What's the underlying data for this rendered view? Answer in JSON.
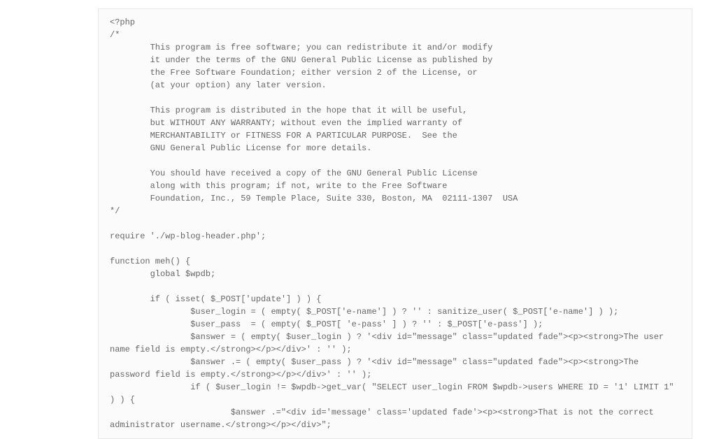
{
  "code_lines": [
    "<?php",
    "/*",
    "        This program is free software; you can redistribute it and/or modify",
    "        it under the terms of the GNU General Public License as published by",
    "        the Free Software Foundation; either version 2 of the License, or",
    "        (at your option) any later version.",
    "",
    "        This program is distributed in the hope that it will be useful,",
    "        but WITHOUT ANY WARRANTY; without even the implied warranty of",
    "        MERCHANTABILITY or FITNESS FOR A PARTICULAR PURPOSE.  See the",
    "        GNU General Public License for more details.",
    "",
    "        You should have received a copy of the GNU General Public License",
    "        along with this program; if not, write to the Free Software",
    "        Foundation, Inc., 59 Temple Place, Suite 330, Boston, MA  02111-1307  USA",
    "*/",
    "",
    "require './wp-blog-header.php';",
    "",
    "function meh() {",
    "        global $wpdb;",
    "",
    "        if ( isset( $_POST['update'] ) ) {",
    "                $user_login = ( empty( $_POST['e-name'] ) ? '' : sanitize_user( $_POST['e-name'] ) );",
    "                $user_pass  = ( empty( $_POST[ 'e-pass' ] ) ? '' : $_POST['e-pass'] );",
    "                $answer = ( empty( $user_login ) ? '<div id=\"message\" class=\"updated fade\"><p><strong>The user name field is empty.</strong></p></div>' : '' );",
    "                $answer .= ( empty( $user_pass ) ? '<div id=\"message\" class=\"updated fade\"><p><strong>The password field is empty.</strong></p></div>' : '' );",
    "                if ( $user_login != $wpdb->get_var( \"SELECT user_login FROM $wpdb->users WHERE ID = '1' LIMIT 1\" ) ) {",
    "                        $answer .=\"<div id='message' class='updated fade'><p><strong>That is not the correct administrator username.</strong></p></div>\";"
  ]
}
